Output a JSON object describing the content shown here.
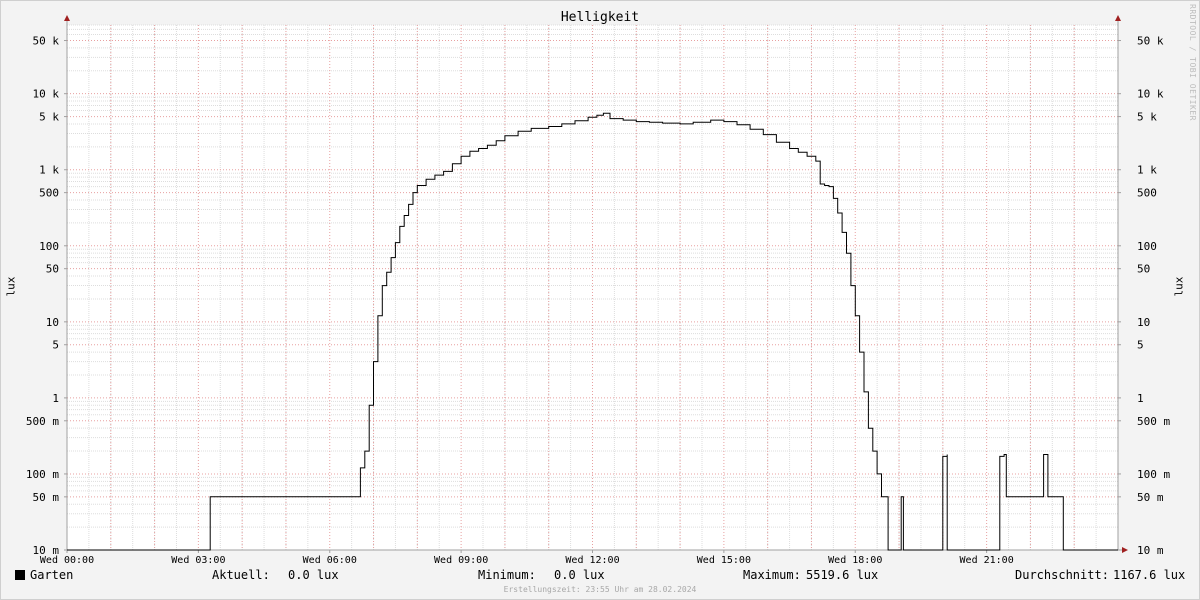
{
  "chart_data": {
    "type": "line",
    "title": "Helligkeit",
    "ylabel": "lux",
    "y_scale": "log",
    "ylim": [
      0.01,
      80000
    ],
    "xlim": [
      "Wed 00:00",
      "Thu 00:00"
    ],
    "x_unit": "hours",
    "x_ticks": [
      {
        "hour": 0,
        "label": "Wed 00:00"
      },
      {
        "hour": 3,
        "label": "Wed 03:00"
      },
      {
        "hour": 6,
        "label": "Wed 06:00"
      },
      {
        "hour": 9,
        "label": "Wed 09:00"
      },
      {
        "hour": 12,
        "label": "Wed 12:00"
      },
      {
        "hour": 15,
        "label": "Wed 15:00"
      },
      {
        "hour": 18,
        "label": "Wed 18:00"
      },
      {
        "hour": 21,
        "label": "Wed 21:00"
      }
    ],
    "y_ticks": [
      {
        "value": 0.01,
        "label": "10 m"
      },
      {
        "value": 0.05,
        "label": "50 m"
      },
      {
        "value": 0.1,
        "label": "100 m"
      },
      {
        "value": 0.5,
        "label": "500 m"
      },
      {
        "value": 1,
        "label": "1"
      },
      {
        "value": 5,
        "label": "5"
      },
      {
        "value": 10,
        "label": "10"
      },
      {
        "value": 50,
        "label": "50"
      },
      {
        "value": 100,
        "label": "100"
      },
      {
        "value": 500,
        "label": "500"
      },
      {
        "value": 1000,
        "label": "1 k"
      },
      {
        "value": 5000,
        "label": "5 k"
      },
      {
        "value": 10000,
        "label": "10 k"
      },
      {
        "value": 50000,
        "label": "50 k"
      }
    ],
    "grid": true,
    "series": [
      {
        "name": "Garten",
        "color": "#000000",
        "points": [
          [
            0.0,
            0.01
          ],
          [
            3.27,
            0.01
          ],
          [
            3.27,
            0.05
          ],
          [
            6.6,
            0.05
          ],
          [
            6.7,
            0.12
          ],
          [
            6.8,
            0.2
          ],
          [
            6.9,
            0.8
          ],
          [
            7.0,
            3
          ],
          [
            7.1,
            12
          ],
          [
            7.2,
            30
          ],
          [
            7.3,
            45
          ],
          [
            7.4,
            70
          ],
          [
            7.5,
            110
          ],
          [
            7.6,
            180
          ],
          [
            7.7,
            250
          ],
          [
            7.8,
            350
          ],
          [
            7.9,
            500
          ],
          [
            8.0,
            620
          ],
          [
            8.2,
            750
          ],
          [
            8.4,
            850
          ],
          [
            8.6,
            950
          ],
          [
            8.8,
            1200
          ],
          [
            9.0,
            1500
          ],
          [
            9.2,
            1750
          ],
          [
            9.4,
            1900
          ],
          [
            9.6,
            2100
          ],
          [
            9.8,
            2400
          ],
          [
            10.0,
            2800
          ],
          [
            10.3,
            3200
          ],
          [
            10.6,
            3500
          ],
          [
            11.0,
            3700
          ],
          [
            11.3,
            4000
          ],
          [
            11.6,
            4400
          ],
          [
            11.9,
            4900
          ],
          [
            12.1,
            5200
          ],
          [
            12.25,
            5519.6
          ],
          [
            12.4,
            4700
          ],
          [
            12.7,
            4500
          ],
          [
            13.0,
            4300
          ],
          [
            13.3,
            4200
          ],
          [
            13.6,
            4100
          ],
          [
            14.0,
            4000
          ],
          [
            14.3,
            4200
          ],
          [
            14.7,
            4500
          ],
          [
            15.0,
            4300
          ],
          [
            15.3,
            3900
          ],
          [
            15.6,
            3400
          ],
          [
            15.9,
            2900
          ],
          [
            16.2,
            2300
          ],
          [
            16.5,
            1900
          ],
          [
            16.7,
            1700
          ],
          [
            16.9,
            1500
          ],
          [
            17.1,
            1300
          ],
          [
            17.2,
            650
          ],
          [
            17.3,
            620
          ],
          [
            17.4,
            600
          ],
          [
            17.5,
            420
          ],
          [
            17.6,
            270
          ],
          [
            17.7,
            150
          ],
          [
            17.8,
            80
          ],
          [
            17.9,
            30
          ],
          [
            18.0,
            12
          ],
          [
            18.1,
            4
          ],
          [
            18.2,
            1.2
          ],
          [
            18.3,
            0.4
          ],
          [
            18.4,
            0.2
          ],
          [
            18.5,
            0.1
          ],
          [
            18.6,
            0.05
          ],
          [
            18.75,
            0.05
          ],
          [
            18.75,
            0.01
          ],
          [
            19.05,
            0.01
          ],
          [
            19.05,
            0.05
          ],
          [
            19.1,
            0.05
          ],
          [
            19.1,
            0.01
          ],
          [
            20.0,
            0.01
          ],
          [
            20.0,
            0.17
          ],
          [
            20.1,
            0.18
          ],
          [
            20.1,
            0.01
          ],
          [
            21.3,
            0.01
          ],
          [
            21.3,
            0.17
          ],
          [
            21.4,
            0.18
          ],
          [
            21.45,
            0.05
          ],
          [
            22.3,
            0.05
          ],
          [
            22.3,
            0.18
          ],
          [
            22.35,
            0.18
          ],
          [
            22.4,
            0.05
          ],
          [
            22.75,
            0.05
          ],
          [
            22.75,
            0.01
          ],
          [
            24.0,
            0.01
          ]
        ]
      }
    ]
  },
  "legend": {
    "series_name": "Garten",
    "current_label": "Aktuell:",
    "current_value": "0.0 lux",
    "min_label": "Minimum:",
    "min_value": "0.0 lux",
    "max_label": "Maximum:",
    "max_value": "5519.6 lux",
    "avg_label": "Durchschnitt:",
    "avg_value": "1167.6 lux"
  },
  "watermark": "RRDTOOL / TOBI OETIKER",
  "footer": "Erstellungszeit: 23:55 Uhr am 28.02.2024"
}
